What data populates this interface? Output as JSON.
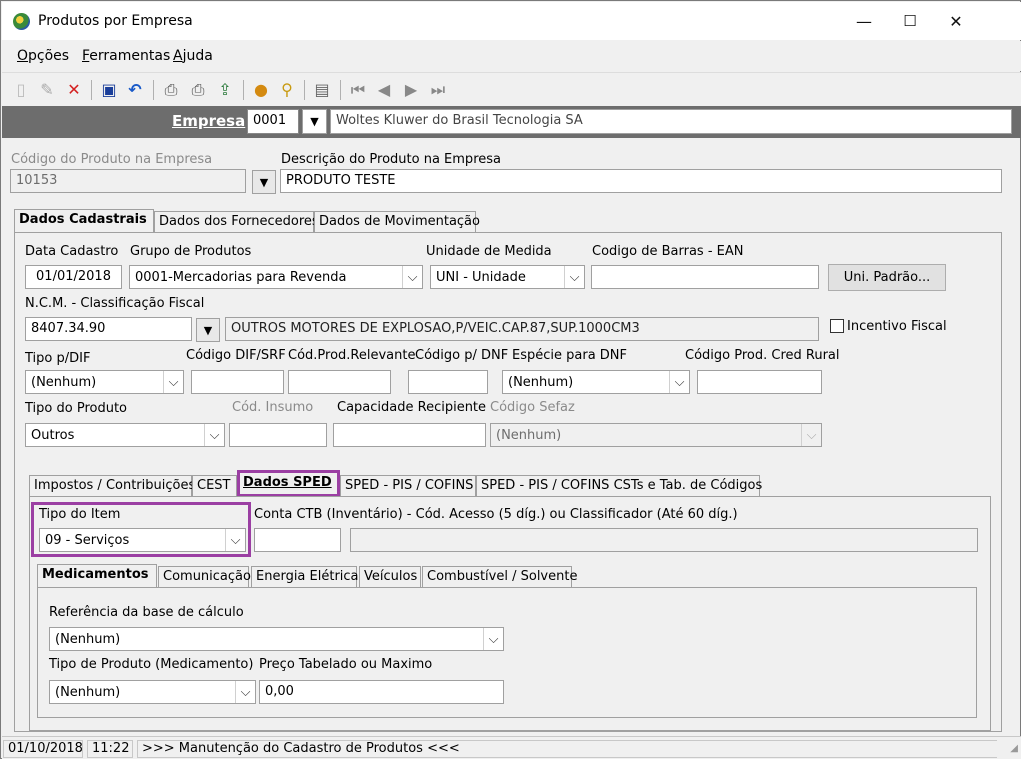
{
  "window": {
    "title": "Produtos por Empresa",
    "minimize": "—",
    "maximize": "☐",
    "close": "✕"
  },
  "menu": {
    "items": [
      "Opções",
      "Ferramentas",
      "Ajuda"
    ],
    "underline": [
      "O",
      "F",
      "A"
    ],
    "rest": [
      "pções",
      "erramentas",
      "juda"
    ]
  },
  "toolbar": {
    "icons": [
      "new-icon",
      "edit-icon",
      "delete-icon",
      "save-icon",
      "undo-icon",
      "print-icon",
      "print-preview-icon",
      "export-icon",
      "lookup-icon",
      "search-icon",
      "config-icon",
      "first-record-icon",
      "prev-record-icon",
      "next-record-icon",
      "last-record-icon"
    ]
  },
  "empresa": {
    "label": "Empresa",
    "code": "0001",
    "name": "Woltes Kluwer do Brasil Tecnologia SA"
  },
  "produto": {
    "code_label": "Código do Produto na Empresa",
    "code_value": "10153",
    "desc_label": "Descrição do Produto na Empresa",
    "desc_value": "PRODUTO TESTE"
  },
  "main_tabs": [
    "Dados Cadastrais",
    "Dados dos Fornecedores",
    "Dados de Movimentação"
  ],
  "cadastro": {
    "data_label": "Data Cadastro",
    "data_value": "01/01/2018",
    "grupo_label": "Grupo de Produtos",
    "grupo_value": "0001-Mercadorias para Revenda",
    "unidade_label": "Unidade de Medida",
    "unidade_value": "UNI - Unidade",
    "ean_label": "Codigo de Barras - EAN",
    "ean_value": "",
    "uni_padrao_button": "Uni. Padrão...",
    "ncm_label": "N.C.M. -  Classificação Fiscal",
    "ncm_value": "8407.34.90",
    "ncm_desc": "OUTROS MOTORES DE EXPLOSAO,P/VEIC.CAP.87,SUP.1000CM3",
    "incentivo_label": "Incentivo Fiscal",
    "tipo_dif_label": "Tipo p/DIF",
    "tipo_dif_value": "(Nenhum)",
    "cod_dif_label": "Código DIF/SRF",
    "cod_relevante_label": "Cód.Prod.Relevante",
    "cod_dnf_label": "Código p/ DNF",
    "especie_dnf_label": "Espécie para DNF",
    "especie_dnf_value": "(Nenhum)",
    "cod_cred_label": "Código Prod. Cred Rural",
    "tipo_produto_label": "Tipo do Produto",
    "tipo_produto_value": "Outros",
    "cod_insumo_label": "Cód. Insumo",
    "capacidade_label": "Capacidade Recipiente",
    "sefaz_label": "Código Sefaz",
    "sefaz_value": "(Nenhum)"
  },
  "sub_tabs": [
    "Impostos / Contribuições",
    "CEST",
    "Dados SPED",
    "SPED - PIS / COFINS",
    "SPED - PIS / COFINS CSTs e Tab. de Códigos"
  ],
  "sped": {
    "tipo_item_label": "Tipo do Item",
    "tipo_item_value": "09 - Serviços",
    "conta_label": "Conta CTB (Inventário) - Cód. Acesso (5 díg.) ou Classificador (Até 60 díg.)"
  },
  "sped_tabs": [
    "Medicamentos",
    "Comunicação",
    "Energia Elétrica",
    "Veículos",
    "Combustível / Solvente"
  ],
  "medicamentos": {
    "ref_label": "Referência da base de cálculo",
    "ref_value": "(Nenhum)",
    "tipo_label": "Tipo de Produto (Medicamento)",
    "tipo_value": "(Nenhum)",
    "preco_label": "Preço Tabelado ou Maximo",
    "preco_value": "0,00"
  },
  "status": {
    "date": "01/10/2018",
    "time": "11:22",
    "message": ">>> Manutenção do Cadastro de Produtos <<<"
  },
  "colors": {
    "highlight": "#9b3fa3",
    "empresa_bar": "#6d6d6d"
  }
}
